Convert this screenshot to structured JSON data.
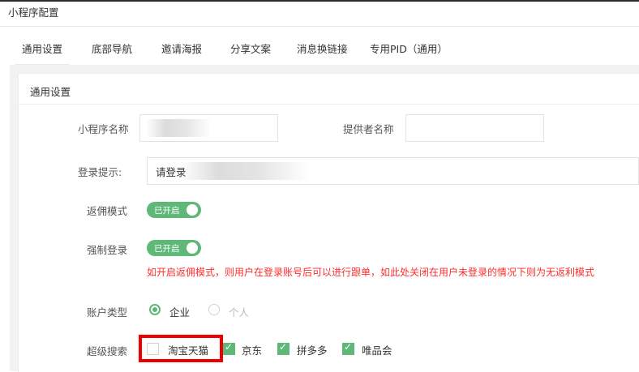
{
  "page": {
    "title": "小程序配置"
  },
  "tabs": [
    {
      "label": "通用设置",
      "active": true
    },
    {
      "label": "底部导航"
    },
    {
      "label": "邀请海报"
    },
    {
      "label": "分享文案"
    },
    {
      "label": "消息换链接"
    },
    {
      "label": "专用PID（通用）"
    }
  ],
  "panel": {
    "title": "通用设置"
  },
  "form": {
    "app_name": {
      "label": "小程序名称",
      "value": ""
    },
    "provider": {
      "label": "提供者名称",
      "value": ""
    },
    "login_tip": {
      "label": "登录提示:",
      "value": "请登录"
    },
    "rebate_mode": {
      "label": "返佣模式",
      "switch_text": "已开启",
      "on": true
    },
    "force_login": {
      "label": "强制登录",
      "switch_text": "已开启",
      "on": true
    },
    "hint": "如开启返佣模式，则用户在登录账号后可以进行跟单，如此处关闭在用户未登录的情况下则为无返利模式",
    "account_type": {
      "label": "账户类型",
      "options": [
        {
          "label": "企业",
          "selected": true
        },
        {
          "label": "个人",
          "selected": false
        }
      ]
    },
    "super_search": {
      "label": "超级搜索",
      "options": [
        {
          "label": "淘宝天猫",
          "checked": false
        },
        {
          "label": "京东",
          "checked": true
        },
        {
          "label": "拼多多",
          "checked": true
        },
        {
          "label": "唯品会",
          "checked": true
        }
      ]
    }
  },
  "colors": {
    "accent": "#5fb878",
    "hint": "#ff2d2d",
    "highlight": "#ee0000"
  }
}
